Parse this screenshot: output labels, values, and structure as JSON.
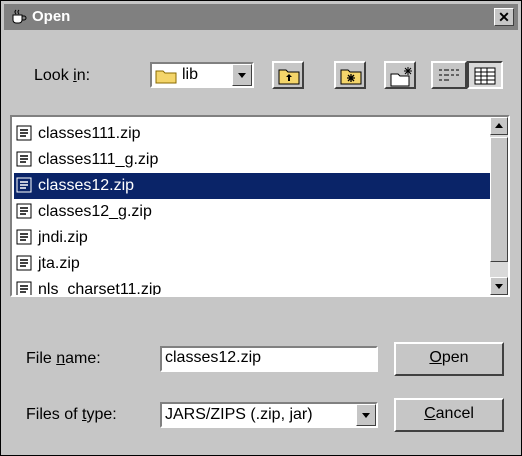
{
  "window": {
    "title": "Open",
    "close_glyph": "✕"
  },
  "toolbar": {
    "look_in_pre": "Look ",
    "look_in_mn": "i",
    "look_in_post": "n:",
    "look_in_value": "lib",
    "icons": [
      "up-one-level-icon",
      "home-folder-icon",
      "new-folder-icon",
      "list-view-icon",
      "details-view-icon"
    ]
  },
  "files": [
    {
      "name": "classes111.zip",
      "selected": false
    },
    {
      "name": "classes111_g.zip",
      "selected": false
    },
    {
      "name": "classes12.zip",
      "selected": true
    },
    {
      "name": "classes12_g.zip",
      "selected": false
    },
    {
      "name": "jndi.zip",
      "selected": false
    },
    {
      "name": "jta.zip",
      "selected": false
    },
    {
      "name": "nls_charset11.zip",
      "selected": false
    }
  ],
  "form": {
    "file_name_pre": "File ",
    "file_name_mn": "n",
    "file_name_post": "ame:",
    "file_name_value": "classes12.zip",
    "files_type_pre": "Files of ",
    "files_type_mn": "t",
    "files_type_post": "ype:",
    "files_type_value": "JARS/ZIPS (.zip, jar)"
  },
  "buttons": {
    "open_mn": "O",
    "open_rest": "pen",
    "cancel_mn": "C",
    "cancel_rest": "ancel"
  },
  "colors": {
    "dialog_bg": "#c6c6c6",
    "title_bar": "#808080",
    "selection": "#0a2468"
  }
}
